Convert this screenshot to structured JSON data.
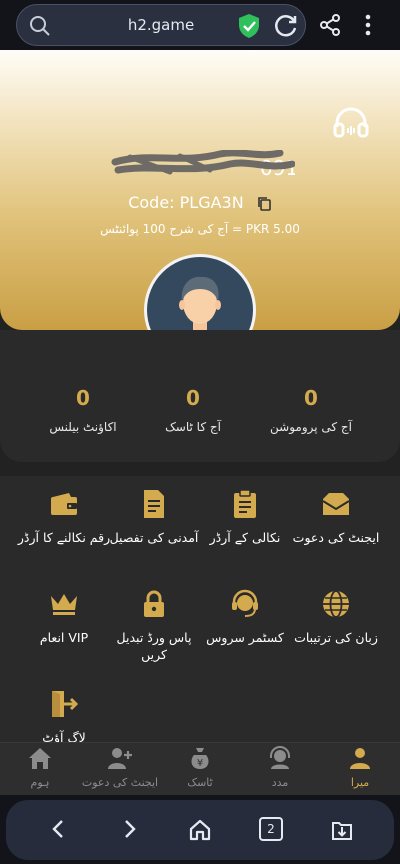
{
  "browser": {
    "url": "h2.game",
    "tab_count": "2",
    "icons": [
      "search-icon",
      "shield-check-icon",
      "reload-icon",
      "share-icon",
      "more-vert-icon",
      "back-icon",
      "forward-icon",
      "home-icon",
      "tabs-icon",
      "download-icon"
    ]
  },
  "profile": {
    "code_text": "Code: PLGA3N",
    "rate_text": "آج کی شرح 100 پوائنٹس = PKR 5.00",
    "phone_visible_tail": "091"
  },
  "stats": [
    {
      "value": "0",
      "label": "آج کی پروموشن"
    },
    {
      "value": "0",
      "label": "آج کا ٹاسک"
    },
    {
      "value": "0",
      "label": "اکاؤنٹ بیلنس"
    }
  ],
  "menu": {
    "row1": [
      {
        "label": "ایجنٹ کی دعوت",
        "icon": "envelope-icon"
      },
      {
        "label": "نکالی کے آرڈر",
        "icon": "clipboard-icon"
      },
      {
        "label": "آمدنی کی تفصیل",
        "icon": "document-icon"
      },
      {
        "label": "رقم نکالنے کا آرڈر",
        "icon": "wallet-icon"
      }
    ],
    "row2": [
      {
        "label": "زبان کی ترتیبات",
        "icon": "globe-icon"
      },
      {
        "label": "کسٹمر سروس",
        "icon": "headset-icon"
      },
      {
        "label": "پاس ورڈ تبدیل کریں",
        "icon": "lock-icon"
      },
      {
        "label": "انعام VIP",
        "icon": "crown-icon"
      }
    ],
    "row3": [
      {
        "label": "لاگ آؤٹ",
        "icon": "logout-icon"
      }
    ]
  },
  "nav": [
    {
      "label": "میرا",
      "active": true
    },
    {
      "label": "مدد"
    },
    {
      "label": "ٹاسک"
    },
    {
      "label": "ایجنٹ کی دعوت"
    },
    {
      "label": "ہوم"
    }
  ],
  "colors": {
    "accent": "#d4aa4f",
    "background": "#222222",
    "panel": "#2a2a2a"
  }
}
